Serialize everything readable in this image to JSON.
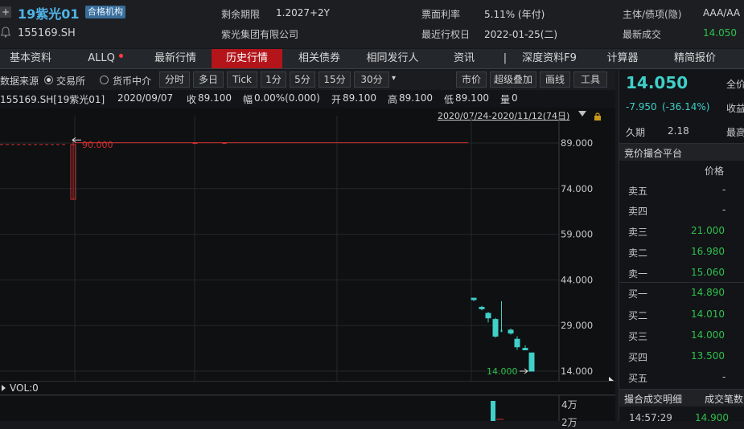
{
  "header": {
    "bond_name": "19紫光01",
    "badge": "合格机构",
    "code": "155169.SH",
    "fields": [
      {
        "label": "剩余期限",
        "value": "1.2027+2Y"
      },
      {
        "label": "紫光集团有限公司",
        "value": ""
      },
      {
        "label": "票面利率",
        "value": "5.11% (年付)"
      },
      {
        "label": "最近行权日",
        "value": "2022-01-25(二)"
      },
      {
        "label": "主体/债项(隐)",
        "value": "AAA/AA"
      },
      {
        "label": "最新成交",
        "value": "14.050"
      }
    ]
  },
  "tabs": [
    "基本资料",
    "ALLQ",
    "最新行情",
    "历史行情",
    "相关债券",
    "相同发行人",
    "资讯",
    "|",
    "深度资料F9",
    "计算器",
    "精简报价"
  ],
  "active_tab": "历史行情",
  "toolbar": {
    "source_label": "数据来源",
    "source_options": [
      "交易所",
      "货币中介"
    ],
    "periods": [
      "分时",
      "多日",
      "Tick",
      "1分",
      "5分",
      "15分",
      "30分",
      "▾"
    ],
    "tools": [
      "市价",
      "超级叠加",
      "画线",
      "工具"
    ]
  },
  "info_line": {
    "symbol": "155169.SH[19紫光01]",
    "date": "2020/09/07",
    "close_label": "收",
    "close": "89.100",
    "change_label": "幅",
    "change": "0.00%(0.000)",
    "open_label": "开",
    "open": "89.100",
    "high_label": "高",
    "high": "89.100",
    "low_label": "低",
    "low": "89.100",
    "vol_label": "量",
    "vol": "0"
  },
  "range_label": "2020/07/24-2020/11/12(74日)",
  "chart_data": {
    "type": "candlestick",
    "y_ticks": [
      "89.000",
      "74.000",
      "59.000",
      "44.000",
      "29.000",
      "14.000"
    ],
    "ylim": [
      14,
      89
    ],
    "annotations": [
      {
        "text": "90.000"
      },
      {
        "text": "14.000"
      }
    ],
    "candles": [
      {
        "o": 88.5,
        "h": 90.0,
        "l": 70.5,
        "c": 70.5
      },
      {
        "o": 89.1,
        "h": 89.1,
        "l": 89.1,
        "c": 89.1
      },
      {
        "o": 89.1,
        "h": 89.1,
        "l": 89.1,
        "c": 89.1
      },
      {
        "o": 38.0,
        "h": 38.0,
        "l": 37.0,
        "c": 37.5
      },
      {
        "o": 35.0,
        "h": 35.5,
        "l": 34.0,
        "c": 34.5
      },
      {
        "o": 33.0,
        "h": 33.5,
        "l": 30.0,
        "c": 31.5
      },
      {
        "o": 31.0,
        "h": 31.5,
        "l": 25.0,
        "c": 25.5
      },
      {
        "o": 27.5,
        "h": 37.0,
        "l": 27.0,
        "c": 27.0
      },
      {
        "o": 26.5,
        "h": 28.0,
        "l": 26.0,
        "c": 27.5
      },
      {
        "o": 24.5,
        "h": 25.5,
        "l": 21.0,
        "c": 22.0
      },
      {
        "o": 21.5,
        "h": 22.5,
        "l": 21.0,
        "c": 21.0
      },
      {
        "o": 14.0,
        "h": 20.0,
        "l": 14.0,
        "c": 20.0
      }
    ],
    "vol_label": "VOL:0",
    "vol_ticks": [
      "4万",
      "2万"
    ]
  },
  "right_panel": {
    "price": "14.050",
    "full_label": "全价",
    "change": "-7.950",
    "change_pct": "(-36.14%)",
    "yield_label": "收益",
    "duration_label": "久期",
    "duration": "2.18",
    "high_label": "最高",
    "platform": "竞价撮合平台",
    "price_col": "价格",
    "sells": [
      {
        "label": "卖五",
        "price": "-"
      },
      {
        "label": "卖四",
        "price": "-"
      },
      {
        "label": "卖三",
        "price": "21.000"
      },
      {
        "label": "卖二",
        "price": "16.980"
      },
      {
        "label": "卖一",
        "price": "15.060"
      }
    ],
    "buys": [
      {
        "label": "买一",
        "price": "14.890"
      },
      {
        "label": "买二",
        "price": "14.010"
      },
      {
        "label": "买三",
        "price": "14.000"
      },
      {
        "label": "买四",
        "price": "13.500"
      },
      {
        "label": "买五",
        "price": "-"
      }
    ],
    "detail_label": "撮合成交明细",
    "count_label": "成交笔数",
    "last_time": "14:57:29",
    "last_price": "14.900"
  },
  "colors": {
    "accent_red": "#b3151b",
    "green": "#2ec04b",
    "cyan": "#3fd0c8",
    "up_red": "#d03030"
  }
}
